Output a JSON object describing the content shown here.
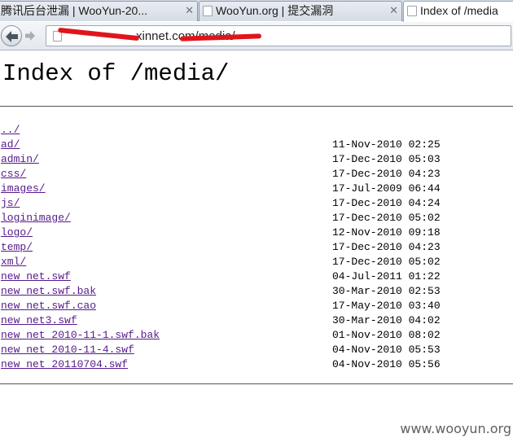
{
  "browser": {
    "tabs": [
      {
        "title": "腾讯后台泄漏 | WooYun-20...",
        "active": false,
        "close": "✕"
      },
      {
        "title": "WooYun.org | 提交漏洞",
        "active": false,
        "close": "✕"
      },
      {
        "title": "Index of /media",
        "active": true,
        "close": ""
      }
    ],
    "address_bar": {
      "url_visible": "xinnet.com/media/",
      "page_icon": "page-icon",
      "redaction_color": "#e0151c"
    },
    "nav": {
      "back_icon": "back-arrow-icon",
      "forward_icon": "forward-arrow-icon"
    }
  },
  "page": {
    "title": "Index of /media/",
    "link_color": "#551a8b",
    "entries": [
      {
        "name": "../",
        "date": ""
      },
      {
        "name": "ad/",
        "date": "11-Nov-2010 02:25"
      },
      {
        "name": "admin/",
        "date": "17-Dec-2010 05:03"
      },
      {
        "name": "css/",
        "date": "17-Dec-2010 04:23"
      },
      {
        "name": "images/",
        "date": "17-Jul-2009 06:44"
      },
      {
        "name": "js/",
        "date": "17-Dec-2010 04:24"
      },
      {
        "name": "loginimage/",
        "date": "17-Dec-2010 05:02"
      },
      {
        "name": "logo/",
        "date": "12-Nov-2010 09:18"
      },
      {
        "name": "temp/",
        "date": "17-Dec-2010 04:23"
      },
      {
        "name": "xml/",
        "date": "17-Dec-2010 05:02"
      },
      {
        "name": "new_net.swf",
        "date": "04-Jul-2011 01:22"
      },
      {
        "name": "new_net.swf.bak",
        "date": "30-Mar-2010 02:53"
      },
      {
        "name": "new_net.swf.cao",
        "date": "17-May-2010 03:40"
      },
      {
        "name": "new_net3.swf",
        "date": "30-Mar-2010 04:02"
      },
      {
        "name": "new_net_2010-11-1.swf.bak",
        "date": "01-Nov-2010 08:02"
      },
      {
        "name": "new_net_2010-11-4.swf",
        "date": "04-Nov-2010 05:53"
      },
      {
        "name": "new_net_20110704.swf",
        "date": "04-Nov-2010 05:56"
      }
    ]
  },
  "watermark": "www.wooyun.org"
}
